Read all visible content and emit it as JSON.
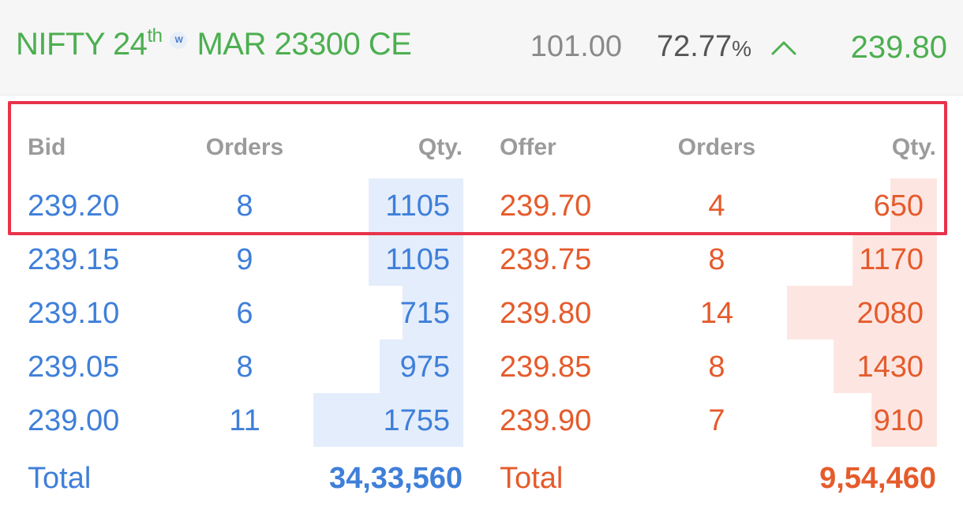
{
  "header": {
    "instrument_prefix": "NIFTY 24",
    "instrument_suffix": "th",
    "weekly_badge": "W",
    "instrument_contract": "MAR 23300 CE",
    "prev_value": "101.00",
    "change_value": "72.77",
    "change_unit": "%",
    "trend_icon": "chevron-up-icon",
    "ltp": "239.80"
  },
  "depth": {
    "columns": {
      "bid": "Bid",
      "bid_orders": "Orders",
      "bid_qty": "Qty.",
      "offer": "Offer",
      "offer_orders": "Orders",
      "offer_qty": "Qty."
    },
    "bids": [
      {
        "price": "239.20",
        "orders": "8",
        "qty": "1105",
        "level": 1105
      },
      {
        "price": "239.15",
        "orders": "9",
        "qty": "1105",
        "level": 1105
      },
      {
        "price": "239.10",
        "orders": "6",
        "qty": "715",
        "level": 715
      },
      {
        "price": "239.05",
        "orders": "8",
        "qty": "975",
        "level": 975
      },
      {
        "price": "239.00",
        "orders": "11",
        "qty": "1755",
        "level": 1755
      }
    ],
    "offers": [
      {
        "price": "239.70",
        "orders": "4",
        "qty": "650",
        "level": 650
      },
      {
        "price": "239.75",
        "orders": "8",
        "qty": "1170",
        "level": 1170
      },
      {
        "price": "239.80",
        "orders": "14",
        "qty": "2080",
        "level": 2080
      },
      {
        "price": "239.85",
        "orders": "8",
        "qty": "1430",
        "level": 1430
      },
      {
        "price": "239.90",
        "orders": "7",
        "qty": "910",
        "level": 910
      }
    ],
    "totals": {
      "bid_label": "Total",
      "bid_total": "34,33,560",
      "offer_label": "Total",
      "offer_total": "9,54,460"
    }
  },
  "colors": {
    "positive": "#4caf50",
    "bid": "#3f7fd9",
    "offer": "#e55b2c",
    "highlight": "#e8334a"
  }
}
